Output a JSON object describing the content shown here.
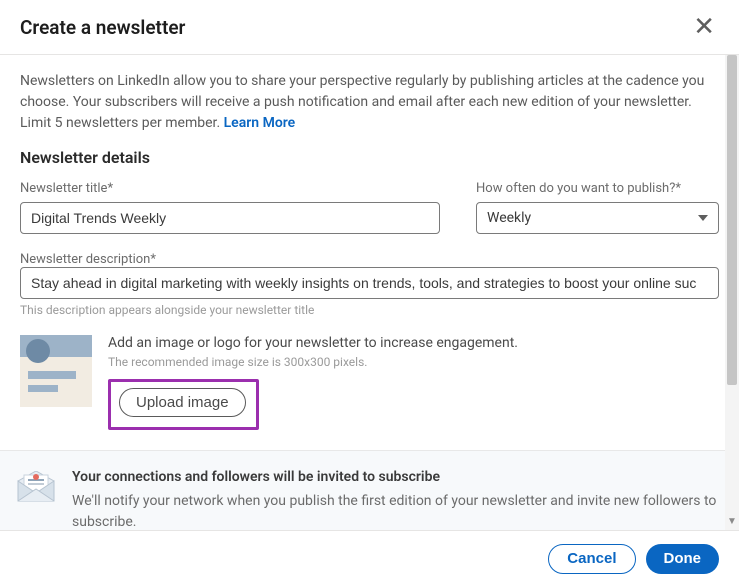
{
  "header": {
    "title": "Create a newsletter"
  },
  "intro": {
    "text": "Newsletters on LinkedIn allow you to share your perspective regularly by publishing articles at the cadence you choose. Your subscribers will receive a push notification and email after each new edition of your newsletter. Limit 5 newsletters per member. ",
    "learn_more": "Learn More"
  },
  "section_heading": "Newsletter details",
  "fields": {
    "title_label": "Newsletter title*",
    "title_value": "Digital Trends Weekly",
    "freq_label": "How often do you want to publish?*",
    "freq_value": "Weekly",
    "desc_label": "Newsletter description*",
    "desc_value": "Stay ahead in digital marketing with weekly insights on trends, tools, and strategies to boost your online suc",
    "desc_helper": "This description appears alongside your newsletter title"
  },
  "image_upload": {
    "title": "Add an image or logo for your newsletter to increase engagement.",
    "rec": "The recommended image size is 300x300 pixels.",
    "button": "Upload image"
  },
  "banner": {
    "title": "Your connections and followers will be invited to subscribe",
    "body": "We'll notify your network when you publish the first edition of your newsletter and invite new followers to subscribe."
  },
  "footer": {
    "cancel": "Cancel",
    "done": "Done"
  }
}
